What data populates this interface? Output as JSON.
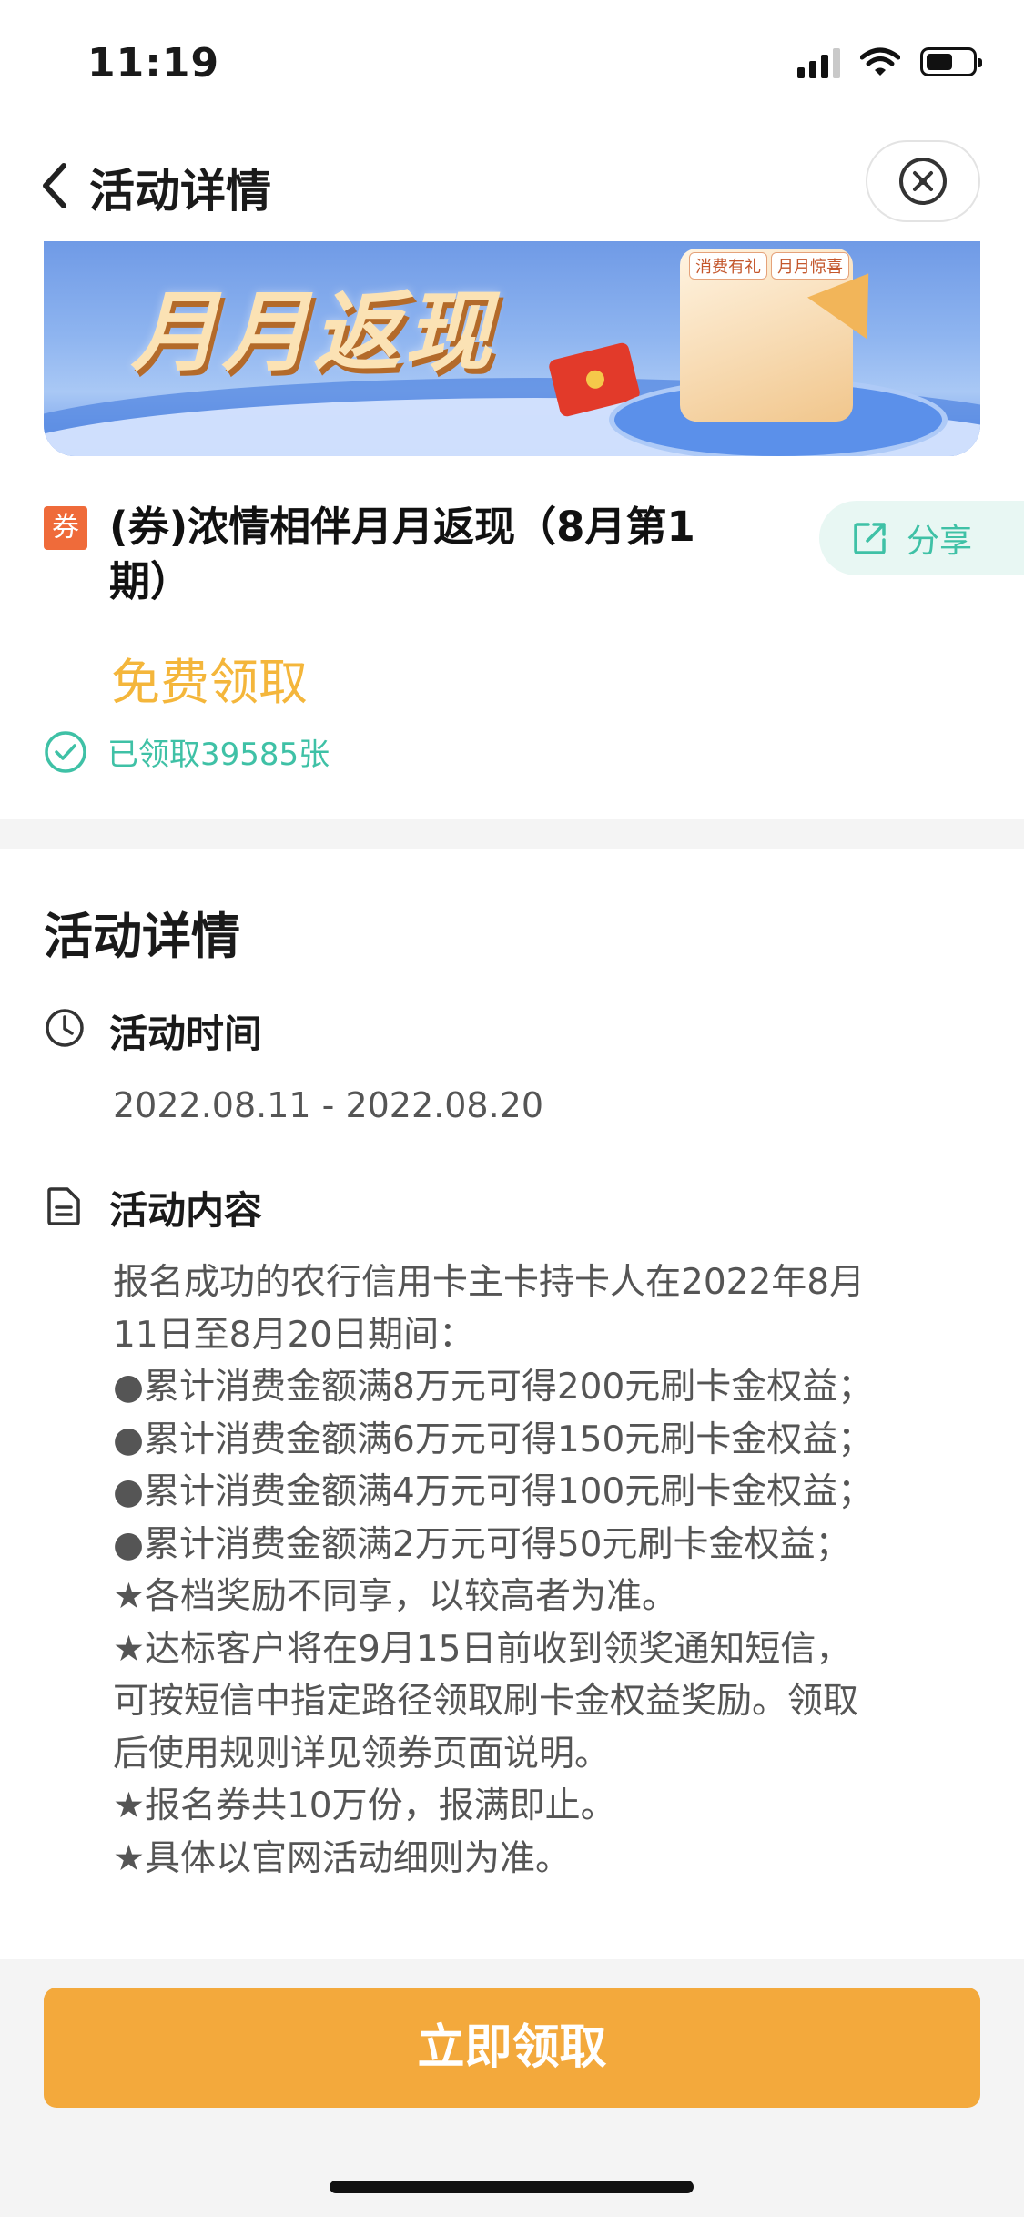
{
  "status_bar": {
    "time": "11:19"
  },
  "nav": {
    "title": "活动详情"
  },
  "banner": {
    "title": "月月返现",
    "tags": [
      "消费有礼",
      "月月惊喜"
    ]
  },
  "coupon": {
    "badge": "券",
    "title": "(券)浓情相伴月月返现（8月第1期）",
    "share_label": "分享",
    "price": "免费领取",
    "claimed": "已领取39585张"
  },
  "details": {
    "heading": "活动详情",
    "time_label": "活动时间",
    "time_value": "2022.08.11 - 2022.08.20",
    "content_label": "活动内容",
    "content_lines": [
      "报名成功的农行信用卡主卡持卡人在2022年8月",
      "11日至8月20日期间：",
      "●累计消费金额满8万元可得200元刷卡金权益；",
      "●累计消费金额满6万元可得150元刷卡金权益；",
      "●累计消费金额满4万元可得100元刷卡金权益；",
      "●累计消费金额满2万元可得50元刷卡金权益；",
      "★各档奖励不同享，以较高者为准。",
      "★达标客户将在9月15日前收到领奖通知短信，",
      "可按短信中指定路径领取刷卡金权益奖励。领取",
      "后使用规则详见领券页面说明。",
      "★报名券共10万份，报满即止。",
      "★具体以官网活动细则为准。"
    ]
  },
  "footer": {
    "claim_button": "立即领取"
  },
  "colors": {
    "accent_orange": "#f3a93c",
    "accent_green": "#3fc1a6",
    "badge_red": "#ef6b3a"
  }
}
